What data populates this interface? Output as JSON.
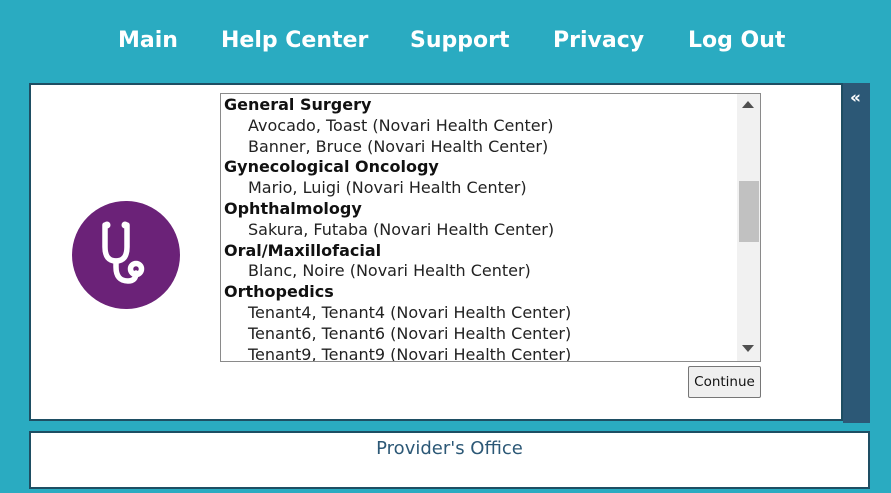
{
  "nav": {
    "items": [
      "Main",
      "Help Center",
      "Support",
      "Privacy",
      "Log Out"
    ]
  },
  "collapse_glyph": "«",
  "avatar_icon": "stethoscope-icon",
  "colors": {
    "background": "#2aabc1",
    "avatar": "#6b2278",
    "sidebar": "#2c5876",
    "border": "#1e4e63"
  },
  "provider_list": [
    {
      "group": "General Surgery",
      "options": [
        "Avocado, Toast (Novari Health Center)",
        "Banner, Bruce (Novari Health Center)"
      ]
    },
    {
      "group": "Gynecological Oncology",
      "options": [
        "Mario, Luigi (Novari Health Center)"
      ]
    },
    {
      "group": "Ophthalmology",
      "options": [
        "Sakura, Futaba (Novari Health Center)"
      ]
    },
    {
      "group": "Oral/Maxillofacial",
      "options": [
        "Blanc, Noire (Novari Health Center)"
      ]
    },
    {
      "group": "Orthopedics",
      "options": [
        "Tenant4, Tenant4 (Novari Health Center)",
        "Tenant6, Tenant6 (Novari Health Center)",
        "Tenant9, Tenant9 (Novari Health Center)"
      ]
    }
  ],
  "continue_label": "Continue",
  "footer": {
    "title": "Provider's Office"
  }
}
